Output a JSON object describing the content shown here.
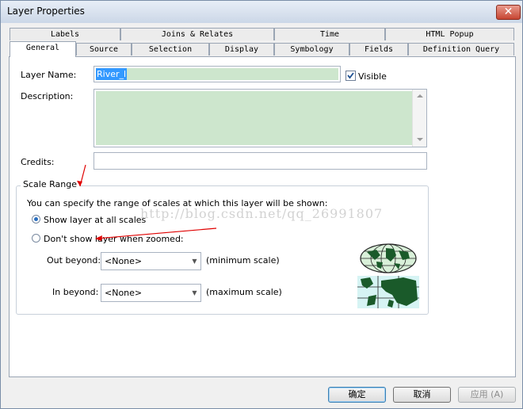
{
  "window": {
    "title": "Layer Properties",
    "close_label": "✕"
  },
  "tabs_row1": [
    "Labels",
    "Joins & Relates",
    "Time",
    "HTML Popup"
  ],
  "tabs_row2": [
    "General",
    "Source",
    "Selection",
    "Display",
    "Symbology",
    "Fields",
    "Definition Query"
  ],
  "active_tab": "General",
  "general": {
    "layer_name_label": "Layer Name:",
    "layer_name_value": "River_l",
    "visible_label": "Visible",
    "visible_checked": true,
    "description_label": "Description:",
    "description_value": "",
    "credits_label": "Credits:",
    "credits_value": ""
  },
  "scale_range": {
    "legend": "Scale Range",
    "intro": "You can specify the range of scales at which this layer will be shown:",
    "option_show_all": "Show layer at all scales",
    "option_dont_show": "Don't show layer when zoomed:",
    "selected": "show_all",
    "out_beyond_label": "Out beyond:",
    "out_beyond_value": "<None>",
    "out_beyond_hint": "(minimum scale)",
    "in_beyond_label": "In beyond:",
    "in_beyond_value": "<None>",
    "in_beyond_hint": "(maximum scale)"
  },
  "watermark": "http://blog.csdn.net/qq_26991807",
  "buttons": {
    "ok": "确定",
    "cancel": "取消",
    "apply": "应用 (A)"
  },
  "icons": [
    "globe-icon",
    "map-icon",
    "scrollbar-up-icon",
    "scrollbar-down-icon",
    "dropdown-arrow-icon"
  ],
  "colors": {
    "name_highlight": "#cde6cd",
    "description_bg": "#cde6cd",
    "annotation_arrow": "#e00000",
    "selection": "#3399ff"
  }
}
